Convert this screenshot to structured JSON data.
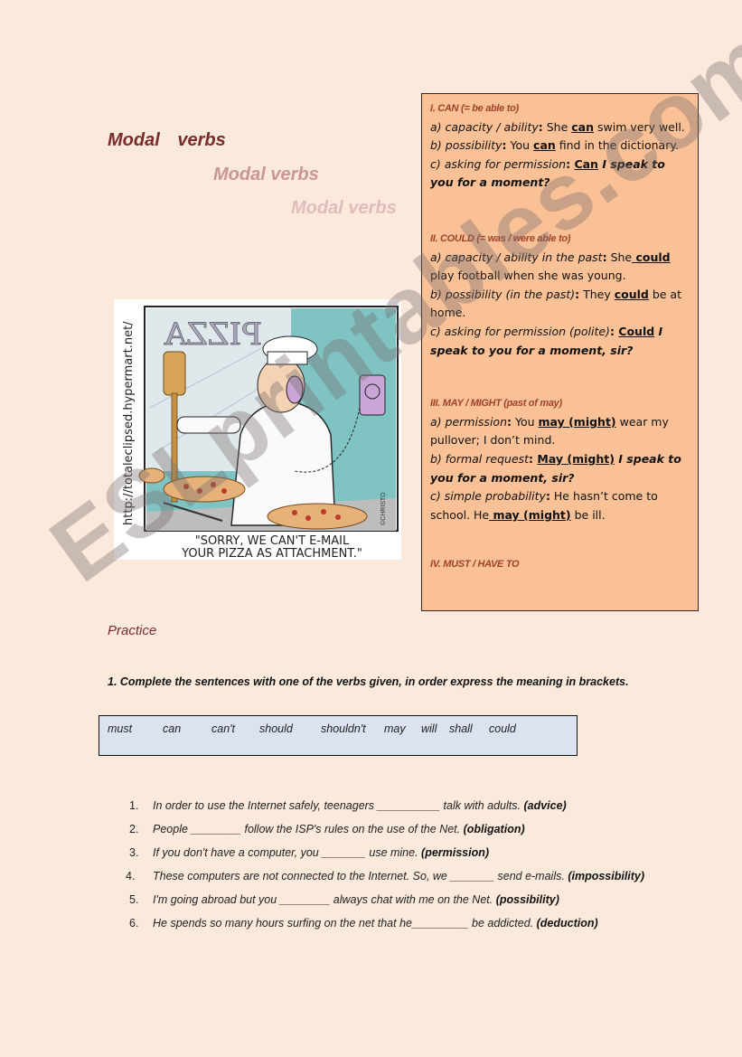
{
  "titles": [
    "Modal verbs",
    "Modal verbs",
    "Modal verbs"
  ],
  "grammar_box": {
    "can": {
      "heading": "I. CAN (= be able to)",
      "a_label": "a) capacity / ability",
      "a_pre": " She ",
      "a_key": "can",
      "a_post": " swim very well.",
      "b_label": "b) possibility",
      "b_pre": " You ",
      "b_key": "can",
      "b_post": " find in the dictionary.",
      "c_label": "c) asking for permission",
      "c_key": "Can",
      "c_post": " I speak to you for a moment?"
    },
    "could": {
      "heading": "II. COULD (= was / were able to)",
      "a_label": "a) capacity / ability in the past",
      "a_pre": " She",
      "a_key": " could",
      "a_post": " play football when she was young.",
      "b_label": "b) possibility (in the past)",
      "b_pre": " They ",
      "b_key": "could",
      "b_post": " be at home.",
      "c_label": "c) asking for permission (polite)",
      "c_key": "Could",
      "c_post": " I speak to you for a moment, sir?"
    },
    "may": {
      "heading": "III. MAY / MIGHT (past of may)",
      "a_label": "a) permission",
      "a_pre": " You ",
      "a_key": "may (might)",
      "a_post": " wear my pullover; I don’t mind.",
      "b_label": "b) formal request",
      "b_key": "May (might)",
      "b_post": " I speak to you for a moment, sir?",
      "c_label": "c) simple probability",
      "c_pre": " He hasn’t come to school. He",
      "c_key": " may (might)",
      "c_post": " be ill."
    },
    "must": {
      "heading": "IV. MUST / HAVE TO"
    }
  },
  "cartoon": {
    "url_text": "http://totaleclipsed.hypermart.net/",
    "sign_text": "PIZZA",
    "caption_line1": "\"SORRY, WE CAN'T E-MAIL",
    "caption_line2": "YOUR PIZZA AS ATTACHMENT.\"",
    "signature": "©CHRISTO"
  },
  "practice": {
    "heading": "Practice",
    "instruction": "1. Complete the sentences with one of the verbs given, in order express the meaning in brackets.",
    "words": [
      "must",
      "can",
      "can't",
      "should",
      "shouldn't",
      "may",
      "will",
      "shall",
      "could"
    ],
    "exercises": [
      {
        "num": "1.",
        "before": "In order to use the Internet safely, teenagers __________ talk with adults. ",
        "hint": "(advice)"
      },
      {
        "num": "2.",
        "before": "People ________ follow the ISP's rules on the use of the Net. ",
        "hint": "(obligation)"
      },
      {
        "num": "3.",
        "before": "If you don't have a computer, you _______ use mine. ",
        "hint": "(permission)"
      },
      {
        "num": "4.",
        "before": "These computers are not connected to the Internet. So, we _______  send e-mails. ",
        "hint": "(impossibility)"
      },
      {
        "num": "5.",
        "before": "I'm going abroad but you ________ always chat with me on the Net.  ",
        "hint": "(possibility)"
      },
      {
        "num": "6.",
        "before": "He spends so many hours surfing on the net that he_________ be addicted. ",
        "hint": "(deduction)"
      }
    ]
  },
  "watermark": "ESLprintables.com"
}
